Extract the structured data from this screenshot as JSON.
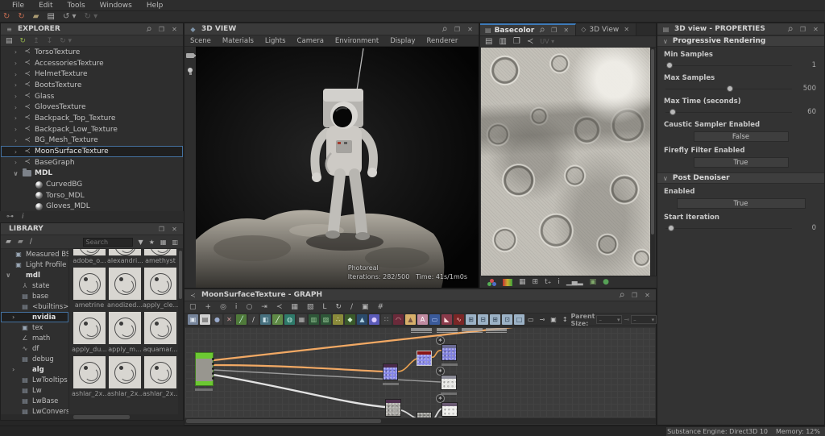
{
  "menubar": {
    "items": [
      "File",
      "Edit",
      "Tools",
      "Windows",
      "Help"
    ]
  },
  "top_toolbar": {
    "icons": [
      {
        "name": "update-graph-icon",
        "g": "↻",
        "fg": "#c06a50"
      },
      {
        "name": "update-all-icon",
        "g": "↻",
        "fg": "#c06a50"
      },
      {
        "name": "open-folder-icon",
        "g": "▰",
        "fg": "#ab9b72"
      },
      {
        "name": "save-icon",
        "g": "▤",
        "fg": "#b8b8b8"
      },
      {
        "name": "undo-icon",
        "g": "↺ ▾",
        "fg": "#9a9a9a"
      },
      {
        "name": "redo-icon",
        "g": "↻ ▾",
        "fg": "#5c5c5c"
      }
    ]
  },
  "explorer": {
    "title": "EXPLORER",
    "toolbar": [
      {
        "name": "save-icon",
        "g": "▤",
        "fg": "#b5b5b5"
      },
      {
        "name": "refresh-icon",
        "g": "↻",
        "fg": "#8fae4a"
      },
      {
        "name": "import-icon",
        "g": "↥",
        "fg": "#5c5c5c"
      },
      {
        "name": "export-icon",
        "g": "↧",
        "fg": "#5c5c5c"
      },
      {
        "name": "link-icon",
        "g": "↻ ▾",
        "fg": "#5c5c5c"
      }
    ],
    "items": [
      {
        "label": "TorsoTexture",
        "chev": "›",
        "icon": "graph",
        "cls": ""
      },
      {
        "label": "AccessoriesTexture",
        "chev": "›",
        "icon": "graph",
        "cls": ""
      },
      {
        "label": "HelmetTexture",
        "chev": "›",
        "icon": "graph",
        "cls": ""
      },
      {
        "label": "BootsTexture",
        "chev": "›",
        "icon": "graph",
        "cls": ""
      },
      {
        "label": "Glass",
        "chev": "›",
        "icon": "graph",
        "cls": ""
      },
      {
        "label": "GlovesTexture",
        "chev": "›",
        "icon": "graph",
        "cls": ""
      },
      {
        "label": "Backpack_Top_Texture",
        "chev": "›",
        "icon": "graph",
        "cls": ""
      },
      {
        "label": "Backpack_Low_Texture",
        "chev": "›",
        "icon": "graph",
        "cls": ""
      },
      {
        "label": "BG_Mesh_Texture",
        "chev": "›",
        "icon": "graph",
        "cls": ""
      },
      {
        "label": "MoonSurfaceTexture",
        "chev": "›",
        "icon": "graph",
        "cls": "sel"
      },
      {
        "label": "BaseGraph",
        "chev": "›",
        "icon": "graph",
        "cls": ""
      },
      {
        "label": "MDL",
        "chev": "∨",
        "icon": "folder",
        "cls": "bold"
      },
      {
        "label": "CurvedBG",
        "chev": "",
        "icon": "sphere",
        "cls": "ind"
      },
      {
        "label": "Torso_MDL",
        "chev": "",
        "icon": "sphere",
        "cls": "ind"
      },
      {
        "label": "Gloves_MDL",
        "chev": "",
        "icon": "sphere",
        "cls": "ind"
      }
    ]
  },
  "library": {
    "title": "LIBRARY",
    "search_placeholder": "Search",
    "toolbar_left": [
      {
        "name": "new-folder-icon",
        "g": "▰",
        "fg": "#a8a8a8"
      },
      {
        "name": "folder-settings-icon",
        "g": "▰",
        "fg": "#8a8a8a"
      },
      {
        "name": "edit-icon",
        "g": "∕",
        "fg": "#b5b5b5"
      }
    ],
    "toolbar_right": [
      {
        "name": "filter-icon",
        "g": "▼",
        "fg": "#b0b0b0"
      },
      {
        "name": "filter-favorites-icon",
        "g": "★",
        "fg": "#b0b0b0"
      },
      {
        "name": "grid-view-icon",
        "g": "▦",
        "fg": "#b0b0b0"
      },
      {
        "name": "detail-view-icon",
        "g": "▥",
        "fg": "#b0b0b0"
      }
    ],
    "folders": [
      {
        "label": "Measured BSDF",
        "chev": "",
        "icon": "img",
        "cls": ""
      },
      {
        "label": "Light Profile",
        "chev": "",
        "icon": "img",
        "cls": ""
      },
      {
        "label": "mdl",
        "chev": "∨",
        "icon": "",
        "cls": "bold"
      },
      {
        "label": "state",
        "chev": "",
        "icon": "person",
        "cls": "ind"
      },
      {
        "label": "base",
        "chev": "",
        "icon": "pkg",
        "cls": "ind"
      },
      {
        "label": "<builtins>",
        "chev": "",
        "icon": "pkg",
        "cls": "ind"
      },
      {
        "label": "nvidia",
        "chev": "›",
        "icon": "",
        "cls": "ind sel bold"
      },
      {
        "label": "tex",
        "chev": "",
        "icon": "img",
        "cls": "ind"
      },
      {
        "label": "math",
        "chev": "",
        "icon": "math",
        "cls": "ind"
      },
      {
        "label": "df",
        "chev": "",
        "icon": "chart",
        "cls": "ind"
      },
      {
        "label": "debug",
        "chev": "",
        "icon": "pkg",
        "cls": "ind"
      },
      {
        "label": "alg",
        "chev": "›",
        "icon": "",
        "cls": "ind bold"
      },
      {
        "label": "LwTooltips",
        "chev": "",
        "icon": "pkg",
        "cls": "ind"
      },
      {
        "label": "Lw",
        "chev": "",
        "icon": "pkg",
        "cls": "ind"
      },
      {
        "label": "LwBase",
        "chev": "",
        "icon": "pkg",
        "cls": "ind"
      },
      {
        "label": "LwConversion",
        "chev": "",
        "icon": "pkg",
        "cls": "ind"
      }
    ],
    "thumbs": [
      {
        "label": "adobe_o...",
        "cls": "partial"
      },
      {
        "label": "alexandri...",
        "cls": "partial"
      },
      {
        "label": "amethyst",
        "cls": "partial"
      },
      {
        "label": "ametrine",
        "cls": ""
      },
      {
        "label": "anodized...",
        "cls": ""
      },
      {
        "label": "apply_cle...",
        "cls": ""
      },
      {
        "label": "apply_du...",
        "cls": ""
      },
      {
        "label": "apply_m...",
        "cls": ""
      },
      {
        "label": "aquamar...",
        "cls": ""
      },
      {
        "label": "ashlar_2x...",
        "cls": ""
      },
      {
        "label": "ashlar_2x...",
        "cls": ""
      },
      {
        "label": "ashlar_2x...",
        "cls": ""
      }
    ]
  },
  "view3d": {
    "title": "3D VIEW",
    "menu": [
      "Scene",
      "Materials",
      "Lights",
      "Camera",
      "Environment",
      "Display",
      "Renderer"
    ],
    "overlay": {
      "mode": "Photoreal",
      "iterations": "Iterations: 282/500",
      "time": "Time: 41s/1m0s"
    }
  },
  "view2d": {
    "tabs": [
      {
        "label": "Basecolor"
      },
      {
        "label": "3D View"
      }
    ],
    "toolbar": [
      {
        "name": "export-image-icon",
        "g": "▤",
        "fg": "#b5b5b5"
      },
      {
        "name": "save-icon",
        "g": "▥",
        "fg": "#b5b5b5"
      },
      {
        "name": "copy-icon",
        "g": "❐",
        "fg": "#b5b5b5"
      },
      {
        "name": "graph-link-icon",
        "g": "≺",
        "fg": "#b5b5b5"
      }
    ],
    "uv_label": "UV ▾",
    "display_toolbar": [
      {
        "name": "checker-icon",
        "g": "▦",
        "fg": "#b0b0b0"
      },
      {
        "name": "grid-icon",
        "g": "⊞",
        "fg": "#b0b0b0"
      },
      {
        "name": "tiling-icon",
        "g": "t₊",
        "fg": "#b0b0b0"
      },
      {
        "name": "info-icon",
        "g": "i",
        "fg": "#b0b0b0"
      },
      {
        "name": "histogram-icon",
        "g": "▁▄▂",
        "fg": "#b0b0b0"
      },
      {
        "name": "image-icon",
        "g": "▣",
        "fg": "#7fa86a"
      },
      {
        "name": "channel-icon",
        "g": "●",
        "fg": "#56a156"
      }
    ]
  },
  "graph": {
    "title": "MoonSurfaceTexture - GRAPH",
    "parent_size_label": "Parent Size:",
    "dropdown_value": "–",
    "tools": [
      "▢",
      "+",
      "◎",
      "i",
      "○",
      "⇥",
      "≺",
      "▦",
      "▧",
      "L",
      "↻",
      "∕",
      "▣",
      "#"
    ],
    "node_buttons": [
      {
        "g": "▣",
        "c": "#76849a",
        "fg": "#dfe6ee"
      },
      {
        "g": "▤",
        "c": "#d0d0d0",
        "fg": "#444444"
      },
      {
        "g": "●",
        "c": "#3b3b3b",
        "fg": "#99aacc"
      },
      {
        "g": "✕",
        "c": "#3b3b3b",
        "fg": "#cc9999"
      },
      {
        "g": "╱",
        "c": "#4f7a3a",
        "fg": "#ccffee"
      },
      {
        "g": "∕",
        "c": "#3b3b3b",
        "fg": "#dddddd"
      },
      {
        "g": "◧",
        "c": "#47707e",
        "fg": "#cfe3ea"
      },
      {
        "g": "╱",
        "c": "#5f8a46",
        "fg": "#eeffee"
      },
      {
        "g": "◍",
        "c": "#2f7a6a",
        "fg": "#bfe8df"
      },
      {
        "g": "▦",
        "c": "#3b3b3b",
        "fg": "#bbbbbb"
      },
      {
        "g": "▥",
        "c": "#2e5638",
        "fg": "#99cc99"
      },
      {
        "g": "▧",
        "c": "#2e5638",
        "fg": "#99cc99"
      },
      {
        "g": "∴",
        "c": "#8a8a3a",
        "fg": "#ffffdd"
      },
      {
        "g": "◆",
        "c": "#3a5a2a",
        "fg": "#cceecc"
      },
      {
        "g": "▲",
        "c": "#2a4a6a",
        "fg": "#aaccdd"
      },
      {
        "g": "●",
        "c": "#5a5ab8",
        "fg": "#ddccff"
      },
      {
        "g": "∷",
        "c": "#3b3b3b",
        "fg": "#bbbbbb"
      },
      {
        "g": "◠",
        "c": "#6a2a3a",
        "fg": "#ddaaaa"
      },
      {
        "g": "▲",
        "c": "#d8b06a",
        "fg": "#775544"
      },
      {
        "g": "A",
        "c": "#c08aa0",
        "fg": "#ffffff"
      },
      {
        "g": "▭",
        "c": "#3a5a9a",
        "fg": "#bbccff"
      },
      {
        "g": "◣",
        "c": "#8a3a4a",
        "fg": "#ffdddd"
      },
      {
        "g": "∿",
        "c": "#7a2626",
        "fg": "#ffbbbb"
      },
      {
        "g": "⊞",
        "c": "#9cb2c6",
        "fg": "#334455"
      },
      {
        "g": "⊟",
        "c": "#9cb2c6",
        "fg": "#334455"
      },
      {
        "g": "⊞",
        "c": "#9cb2c6",
        "fg": "#334455"
      },
      {
        "g": "⊡",
        "c": "#9cb2c6",
        "fg": "#334455"
      },
      {
        "g": "□",
        "c": "#9cb2c6",
        "fg": "#334455"
      }
    ],
    "extra_tools": [
      {
        "name": "comment-icon",
        "g": "▭",
        "fg": "#c0c0c0"
      },
      {
        "name": "link-dot-icon",
        "g": "⊸",
        "fg": "#c0c0c0"
      },
      {
        "name": "frame-icon",
        "g": "▣",
        "fg": "#c0c0c0"
      },
      {
        "name": "pin-input-icon",
        "g": "↕",
        "fg": "#c0c0c0"
      }
    ],
    "more_label": "»"
  },
  "properties": {
    "title": "3D view - PROPERTIES",
    "progressive_rendering": {
      "title": "Progressive Rendering",
      "min_samples": {
        "label": "Min Samples",
        "value": "1"
      },
      "max_samples": {
        "label": "Max Samples",
        "value": "500"
      },
      "max_time": {
        "label": "Max Time (seconds)",
        "value": "60"
      },
      "caustic": {
        "label": "Caustic Sampler Enabled",
        "value": "False"
      },
      "firefly": {
        "label": "Firefly Filter Enabled",
        "value": "True"
      }
    },
    "post_denoiser": {
      "title": "Post Denoiser",
      "enabled": {
        "label": "Enabled",
        "value": "True"
      },
      "start_iteration": {
        "label": "Start Iteration",
        "value": "0"
      }
    }
  },
  "statusbar": {
    "engine": "Substance Engine: Direct3D 10",
    "memory": "Memory: 12%"
  }
}
